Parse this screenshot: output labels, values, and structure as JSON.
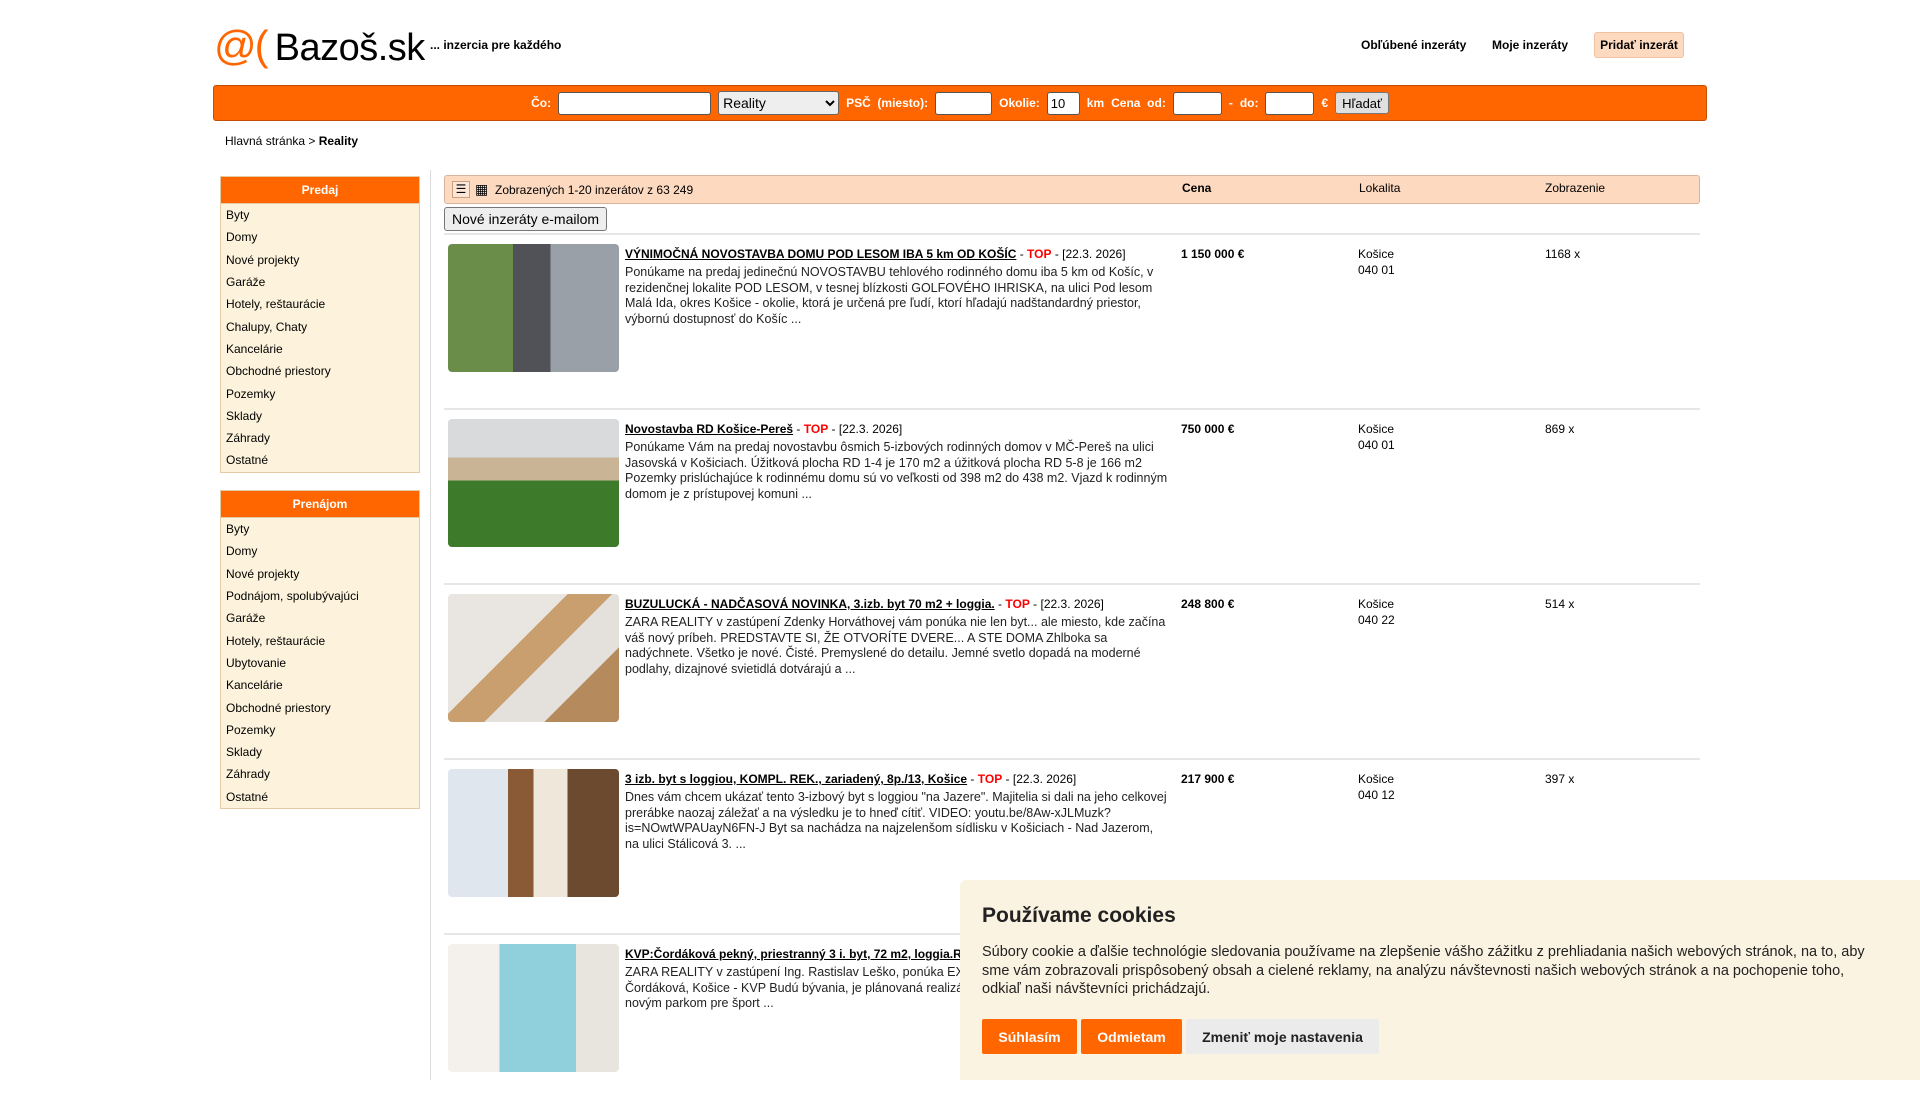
{
  "header": {
    "logo_at": "@(",
    "logo_name": "Bazoš.sk",
    "tagline": "... inzercia pre každého",
    "links": [
      "Obľúbené inzeráty",
      "Moje inzeráty"
    ],
    "add_button": "Pridať inzerát"
  },
  "search": {
    "co_label": "Čo:",
    "co_value": "",
    "category": "Reality",
    "psc_label": "PSČ  (miesto):",
    "okolie_label": "Okolie:",
    "okolie_value": "10",
    "km": "km",
    "cena_label": "Cena  od:",
    "dash": "-",
    "do_label": "do:",
    "euro": "€",
    "button": "Hľadať"
  },
  "breadcrumb": {
    "home": "Hlavná stránka",
    "sep": " > ",
    "current": "Reality"
  },
  "sidebar": {
    "predaj": {
      "title": "Predaj",
      "items": [
        "Byty",
        "Domy",
        "Nové projekty",
        "Garáže",
        "Hotely, reštaurácie",
        "Chalupy, Chaty",
        "Kancelárie",
        "Obchodné priestory",
        "Pozemky",
        "Sklady",
        "Záhrady",
        "Ostatné"
      ]
    },
    "prenajom": {
      "title": "Prenájom",
      "items": [
        "Byty",
        "Domy",
        "Nové projekty",
        "Podnájom, spolubývajúci",
        "Garáže",
        "Hotely, reštaurácie",
        "Ubytovanie",
        "Kancelárie",
        "Obchodné priestory",
        "Pozemky",
        "Sklady",
        "Záhrady",
        "Ostatné"
      ]
    }
  },
  "list_header": {
    "count": "Zobrazených 1-20 inzerátov z 63 249",
    "cena": "Cena",
    "lokalita": "Lokalita",
    "zobrazenie": "Zobrazenie",
    "email_button": "Nové inzeráty e-mailom"
  },
  "listings": [
    {
      "title": "VÝNIMOČNÁ NOVOSTAVBA DOMU POD LESOM IBA 5 km OD KOŠÍC",
      "top": "TOP",
      "date": "[22.3. 2026]",
      "desc": "Ponúkame na predaj jedinečnú NOVOSTAVBU tehlového rodinného domu iba 5 km od Košíc, v rezidenčnej lokalite POD LESOM, v tesnej blízkosti GOLFOVÉHO IHRISKA, na ulici Pod lesom Malá Ida, okres Košice - okolie, ktorá je určená pre ľudí, ktorí hľadajú nadštandardný priestor, výbornú dostupnosť do Košíc ...",
      "price": "1 150 000 €",
      "city": "Košice",
      "zip": "040 01",
      "views": "1168 x"
    },
    {
      "title": "Novostavba RD Košice-Pereš",
      "top": "TOP",
      "date": "[22.3. 2026]",
      "desc": "Ponúkame Vám na predaj novostavbu ôsmich 5-izbových rodinných domov v MČ-Pereš na ulici Jasovská v Košiciach. Úžitková plocha RD 1-4 je 170 m2 a úžitková plocha RD 5-8 je 166 m2 Pozemky prislúchajúce k rodinnému domu sú vo veľkosti od 398 m2 do 438 m2.  Vjazd k rodinným domom je z prístupovej komuni ...",
      "price": "750 000 €",
      "city": "Košice",
      "zip": "040 01",
      "views": "869 x"
    },
    {
      "title": "BUZULUCKÁ - NADČASOVÁ NOVINKA, 3.izb. byt 70 m2 + loggia.",
      "top": "TOP",
      "date": "[22.3. 2026]",
      "desc": "ZARA REALITY v zastúpení Zdenky Horváthovej vám ponúka nie len byt... ale miesto, kde začína váš nový príbeh. PREDSTAVTE SI, ŽE OTVORÍTE DVERE... A STE DOMA Zhlboka sa nadýchnete. Všetko je nové. Čisté. Premyslené do detailu. Jemné svetlo dopadá na moderné podlahy, dizajnové svietidlá dotvárajú a ...",
      "price": "248 800 €",
      "city": "Košice",
      "zip": "040 22",
      "views": "514 x"
    },
    {
      "title": "3 izb. byt s loggiou, KOMPL. REK., zariadený, 8p./13, Košice",
      "top": "TOP",
      "date": "[22.3. 2026]",
      "desc": "Dnes vám chcem ukázať tento 3-izbový byt s loggiou \"na Jazere\". Majitelia si dali na jeho celkovej prerábke naozaj záležať a na výsledku je to hneď cítiť. VIDEO: youtu.be/8Aw-xJLMuzk?is=NOwtWPAUayN6FN-J Byt sa nachádza na najzelenšom sídlisku v Košiciach - Nad Jazerom, na ulici Stálicová 3. ...",
      "price": "217 900 €",
      "city": "Košice",
      "zip": "040 12",
      "views": "397 x"
    },
    {
      "title": "KVP:Čordáková pekný, priestranný 3 i. byt, 72 m2, loggia.R",
      "top": "",
      "date": "",
      "desc": "ZARA REALITY v zastúpení Ing. Rastislav Leško, ponúka EXKl farebne zladený 3 izbový byt ul. Čordáková, Košice - KVP Budú bývania, je plánovaná realizácia obnovy vnútrobloku medzi ulic novým parkom pre šport ...",
      "price": "",
      "city": "",
      "zip": "",
      "views": ""
    }
  ],
  "cookie": {
    "title": "Používame cookies",
    "body": "Súbory cookie a ďalšie technológie sledovania používame na zlepšenie vášho zážitku z prehliadania našich webových stránok, na to, aby sme vám zobrazovali prispôsobený obsah a cielené reklamy, na analýzu návštevnosti našich webových stránok a na pochopenie toho, odkiaľ naši návštevníci prichádzajú.",
    "accept": "Súhlasím",
    "reject": "Odmietam",
    "settings": "Zmeniť moje nastavenia"
  },
  "colors": {
    "accent": "#ff6600",
    "header_bg": "#fdd9c0",
    "sidebar_bg": "#fdf3dc",
    "cookie_bg": "#fbf3e2"
  }
}
